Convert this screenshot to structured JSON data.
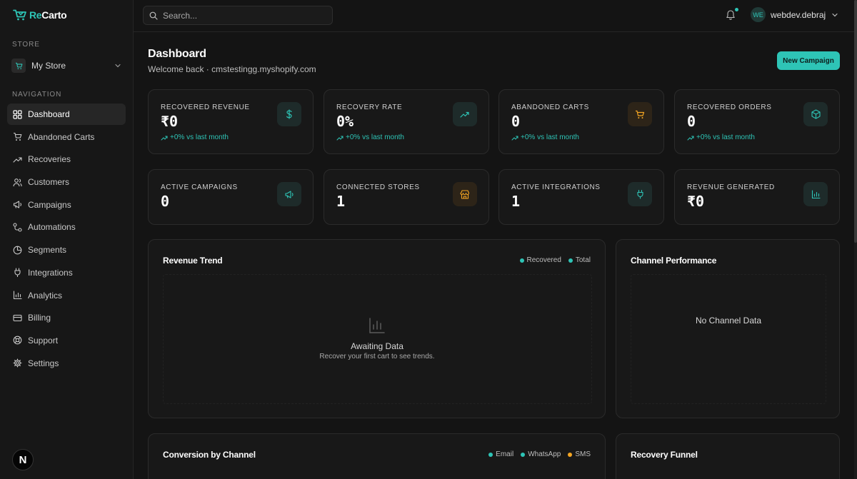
{
  "brand": {
    "name_part1": "Re",
    "name_part2": "Carto",
    "accent": "#2ec4b6"
  },
  "sidebar": {
    "store_label": "STORE",
    "store_name": "My Store",
    "nav_label": "NAVIGATION",
    "items": [
      {
        "label": "Dashboard",
        "icon": "grid-icon",
        "active": true
      },
      {
        "label": "Abandoned Carts",
        "icon": "cart-icon"
      },
      {
        "label": "Recoveries",
        "icon": "trending-up-icon"
      },
      {
        "label": "Customers",
        "icon": "users-icon"
      },
      {
        "label": "Campaigns",
        "icon": "megaphone-icon"
      },
      {
        "label": "Automations",
        "icon": "workflow-icon"
      },
      {
        "label": "Segments",
        "icon": "pie-icon"
      },
      {
        "label": "Integrations",
        "icon": "plug-icon"
      },
      {
        "label": "Analytics",
        "icon": "bar-chart-icon"
      },
      {
        "label": "Billing",
        "icon": "credit-card-icon"
      },
      {
        "label": "Support",
        "icon": "lifebuoy-icon"
      },
      {
        "label": "Settings",
        "icon": "gear-icon"
      }
    ],
    "badge": "N"
  },
  "topbar": {
    "search_placeholder": "Search...",
    "user_initials": "WE",
    "username": "webdev.debraj"
  },
  "header": {
    "title": "Dashboard",
    "subtitle": "Welcome back · cmstestingg.myshopify.com",
    "cta": "New Campaign"
  },
  "stats": [
    {
      "label": "RECOVERED REVENUE",
      "value": "₹0",
      "delta": "+0% vs last month",
      "icon": "dollar-icon",
      "tone": "teal"
    },
    {
      "label": "RECOVERY RATE",
      "value": "0%",
      "delta": "+0% vs last month",
      "icon": "trending-up-icon",
      "tone": "teal"
    },
    {
      "label": "ABANDONED CARTS",
      "value": "0",
      "delta": "+0% vs last month",
      "icon": "cart-icon",
      "tone": "orange"
    },
    {
      "label": "RECOVERED ORDERS",
      "value": "0",
      "delta": "+0% vs last month",
      "icon": "package-icon",
      "tone": "teal"
    },
    {
      "label": "ACTIVE CAMPAIGNS",
      "value": "0",
      "icon": "megaphone-icon",
      "tone": "teal"
    },
    {
      "label": "CONNECTED STORES",
      "value": "1",
      "icon": "store-icon",
      "tone": "orange"
    },
    {
      "label": "ACTIVE INTEGRATIONS",
      "value": "1",
      "icon": "plug-icon",
      "tone": "teal"
    },
    {
      "label": "REVENUE GENERATED",
      "value": "₹0",
      "icon": "bar-chart-icon",
      "tone": "teal"
    }
  ],
  "revenue_trend": {
    "title": "Revenue Trend",
    "legend": [
      {
        "label": "Recovered",
        "color": "#2ec4b6"
      },
      {
        "label": "Total",
        "color": "#2ec4b6"
      }
    ],
    "empty_title": "Awaiting Data",
    "empty_sub": "Recover your first cart to see trends."
  },
  "channel_performance": {
    "title": "Channel Performance",
    "empty_title": "No Channel Data"
  },
  "conversion": {
    "title": "Conversion by Channel",
    "legend": [
      {
        "label": "Email",
        "color": "#2ec4b6"
      },
      {
        "label": "WhatsApp",
        "color": "#2ec4b6"
      },
      {
        "label": "SMS",
        "color": "#f5a623"
      }
    ]
  },
  "funnel": {
    "title": "Recovery Funnel"
  }
}
